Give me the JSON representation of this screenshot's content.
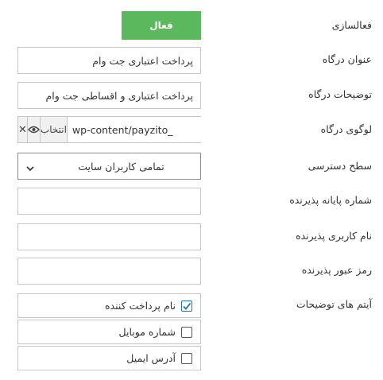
{
  "rows": {
    "activation": {
      "label": "فعالسازی",
      "toggle_label": "فعال"
    },
    "gateway_title": {
      "label": "عنوان درگاه",
      "value": "پرداخت اعتباری جت وام"
    },
    "gateway_description": {
      "label": "توضیحات درگاه",
      "value": "پرداخت اعتباری و اقساطی جت وام"
    },
    "gateway_logo": {
      "label": "لوگوی درگاه",
      "path": "wp-content/payzito_",
      "select_label": "انتخاب",
      "view_icon": "eye-icon",
      "clear_icon": "close-icon"
    },
    "access_level": {
      "label": "سطح دسترسی",
      "selected": "تمامی کاربران سایت"
    },
    "terminal_number": {
      "label": "شماره پایانه پذیرنده",
      "value": ""
    },
    "acceptor_username": {
      "label": "نام کاربری پذیرنده",
      "value": ""
    },
    "acceptor_password": {
      "label": "رمز عبور پذیرنده",
      "value": ""
    },
    "description_items": {
      "label": "آیتم های توضیحات",
      "items": [
        {
          "label": "نام پرداخت کننده",
          "checked": true
        },
        {
          "label": "شماره موبایل",
          "checked": false
        },
        {
          "label": "آدرس ایمیل",
          "checked": false
        }
      ]
    }
  },
  "colors": {
    "accent_green": "#5cb85c",
    "check_blue": "#2271b1",
    "border": "#c6c6c6"
  }
}
